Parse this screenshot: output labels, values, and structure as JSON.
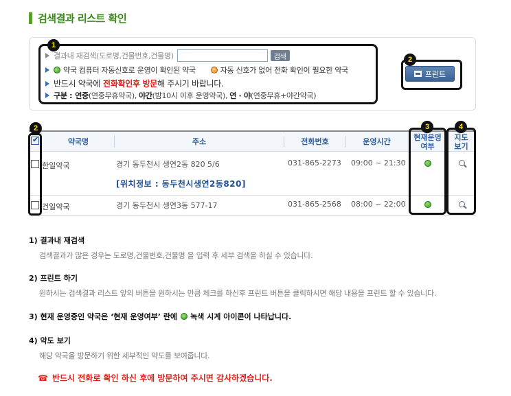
{
  "header": {
    "title": "검색결과 리스트 확인"
  },
  "search": {
    "label": "결과내 재검색(도로명,건물번호,건물명)",
    "input_value": "",
    "button_label": "검색",
    "legend_green": "약국 컴퓨터 자동신호로 운영이 확인된 약국",
    "legend_orange": "자동 신호가 없어 전화 확인이 필요한 약국",
    "notice_pre": "반드시 약국에",
    "notice_red": "전화확인후 방문",
    "notice_post": "해 주시기 바랍니다.",
    "types_label": "구분 :",
    "types_1": "연중",
    "types_1_desc": "(연중무휴약국),",
    "types_2": "야간",
    "types_2_desc": "(밤10시 이후 운영약국),",
    "types_3": "연 · 야",
    "types_3_desc": "(연중무휴+야간약국)"
  },
  "print_button": {
    "label": "프린트"
  },
  "callouts": {
    "c1": "1",
    "c2": "2",
    "c3": "2",
    "c4": "3",
    "c5": "4"
  },
  "table": {
    "headers": {
      "name": "약국명",
      "address": "주소",
      "phone": "전화번호",
      "hours": "운영시간",
      "status_line1": "현재운영",
      "status_line2": "여부",
      "map_line1": "지도",
      "map_line2": "보기"
    },
    "rows": [
      {
        "name": "한일약국",
        "address": "경기 동두천시 생연2동 820 5/6",
        "location": "[위치정보 : 동두천시생연2동820]",
        "phone": "031-865-2273",
        "hours": "09:00 ~ 21:30"
      },
      {
        "name": "건일약국",
        "address": "경기 동두천시 생연3동 577-17",
        "phone": "031-865-2568",
        "hours": "08:00 ~ 22:00"
      }
    ]
  },
  "notes": {
    "n1_title": "1) 결과내 재검색",
    "n1_desc": "검색결과가 많은 경우는 도로명,건물번호,건물명 을 입력 후 세부 검색을 하실 수 있습니다.",
    "n2_title": "2) 프린트 하기",
    "n2_desc": "원하시는 검색결과 리스트 앞의 버튼을 원하시는 만큼 체크를 하신후 프린트 버튼을 클릭하시면 해당 내용을 프린트 할 수 있습니다.",
    "n3_pre": "3) 현재 운영중인 약국은 ‘현재 운영여부’ 란에",
    "n3_post": "녹색 시계 아이콘이 나타납니다.",
    "n4_title": "4) 약도 보기",
    "n4_desc": "해당 약국을 방문하기 위한 세부적인 약도를 보여줍니다.",
    "final": "반드시 전화로 확인 하신 후에 방문하여 주시면 감사하겠습니다."
  },
  "colors": {
    "accent_green": "#5aa02c",
    "header_blue": "#2f5f9a",
    "warning_red": "#e0211b"
  }
}
